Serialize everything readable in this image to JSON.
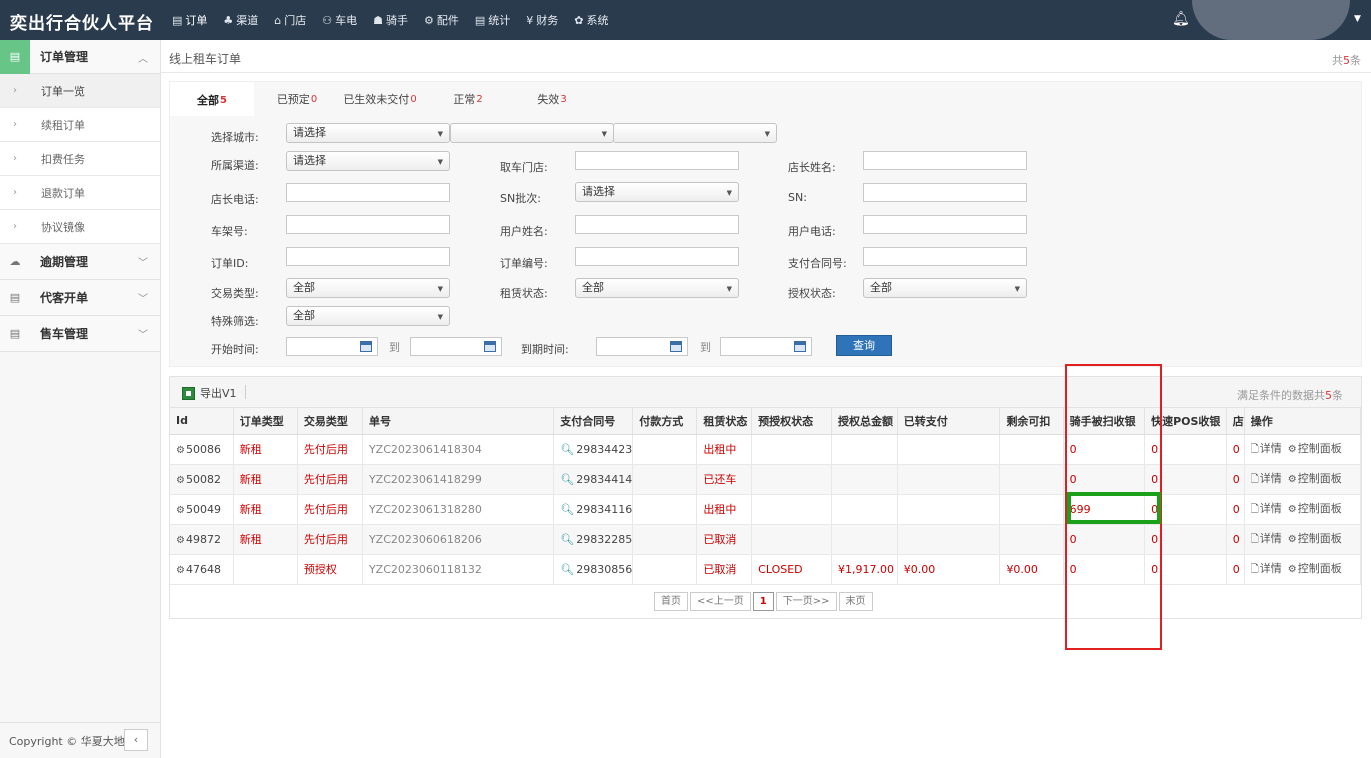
{
  "brand": "奕出行合伙人平台",
  "nav": [
    {
      "icon": "▤",
      "label": "订单",
      "active": true
    },
    {
      "icon": "♣",
      "label": "渠道"
    },
    {
      "icon": "⌂",
      "label": "门店"
    },
    {
      "icon": "⚇",
      "label": "车电"
    },
    {
      "icon": "☗",
      "label": "骑手"
    },
    {
      "icon": "⚙",
      "label": "配件"
    },
    {
      "icon": "▤",
      "label": "统计"
    },
    {
      "icon": "¥",
      "label": "财务"
    },
    {
      "icon": "✿",
      "label": "系统"
    }
  ],
  "sidebar": {
    "groups": [
      {
        "label": "订单管理",
        "chevron": "^"
      },
      {
        "label": "逾期管理",
        "chevron": "v"
      },
      {
        "label": "代客开单",
        "chevron": "v"
      },
      {
        "label": "售车管理",
        "chevron": "v"
      }
    ],
    "sub_items": [
      "订单一览",
      "续租订单",
      "扣费任务",
      "退款订单",
      "协议镜像"
    ],
    "footer": "Copyright © 华夏大地",
    "collapse": "‹"
  },
  "page": {
    "title": "线上租车订单",
    "total_prefix": "共",
    "total_count": "5",
    "total_suffix": "条"
  },
  "tabs": [
    {
      "label": "全部",
      "count": "5"
    },
    {
      "label": "已预定",
      "count": "0"
    },
    {
      "label": "已生效未交付",
      "count": "0"
    },
    {
      "label": "正常",
      "count": "2"
    },
    {
      "label": "失效",
      "count": "3"
    }
  ],
  "filters": {
    "city_label": "选择城市:",
    "city_value": "请选择",
    "channel_label": "所属渠道:",
    "channel_value": "请选择",
    "pickup_store_label": "取车门店:",
    "manager_name_label": "店长姓名:",
    "manager_phone_label": "店长电话:",
    "sn_batch_label": "SN批次:",
    "sn_batch_value": "请选择",
    "sn_label": "SN:",
    "frame_label": "车架号:",
    "user_name_label": "用户姓名:",
    "user_phone_label": "用户电话:",
    "order_id_label": "订单ID:",
    "order_no_label": "订单编号:",
    "contract_no_label": "支付合同号:",
    "trade_type_label": "交易类型:",
    "trade_type_value": "全部",
    "rent_status_label": "租赁状态:",
    "rent_status_value": "全部",
    "auth_status_label": "授权状态:",
    "auth_status_value": "全部",
    "special_label": "特殊筛选:",
    "special_value": "全部",
    "start_label": "开始时间:",
    "to1": "到",
    "expire_label": "到期时间:",
    "to2": "到",
    "query_button": "查询"
  },
  "table": {
    "export_label": "导出V1",
    "meta_prefix": "满足条件的数据共",
    "meta_count": "5",
    "meta_suffix": "条",
    "columns": [
      "Id",
      "订单类型",
      "交易类型",
      "单号",
      "支付合同号",
      "付款方式",
      "租赁状态",
      "预授权状态",
      "授权总金额",
      "已转支付",
      "剩余可扣",
      "骑手被扫收银",
      "快速POS收银",
      "店",
      "操作"
    ],
    "rows": [
      {
        "id": "50086",
        "order_type": "新租",
        "trade_type": "先付后用",
        "order_no": "YZC2023061418304",
        "contract": "29834423",
        "pay": "",
        "status": "出租中",
        "preauth": "",
        "auth_total": "",
        "transferred": "",
        "remaining": "",
        "rider_scan": "0",
        "pos": "0",
        "store": "0"
      },
      {
        "id": "50082",
        "order_type": "新租",
        "trade_type": "先付后用",
        "order_no": "YZC2023061418299",
        "contract": "29834414",
        "pay": "",
        "status": "已还车",
        "preauth": "",
        "auth_total": "",
        "transferred": "",
        "remaining": "",
        "rider_scan": "0",
        "pos": "0",
        "store": "0"
      },
      {
        "id": "50049",
        "order_type": "新租",
        "trade_type": "先付后用",
        "order_no": "YZC2023061318280",
        "contract": "29834116",
        "pay": "",
        "status": "出租中",
        "preauth": "",
        "auth_total": "",
        "transferred": "",
        "remaining": "",
        "rider_scan": "699",
        "pos": "0",
        "store": "0"
      },
      {
        "id": "49872",
        "order_type": "新租",
        "trade_type": "先付后用",
        "order_no": "YZC2023060618206",
        "contract": "29832285",
        "pay": "",
        "status": "已取消",
        "preauth": "",
        "auth_total": "",
        "transferred": "",
        "remaining": "",
        "rider_scan": "0",
        "pos": "0",
        "store": "0"
      },
      {
        "id": "47648",
        "order_type": "",
        "trade_type": "预授权",
        "order_no": "YZC2023060118132",
        "contract": "29830856",
        "pay": "",
        "status": "已取消",
        "preauth": "CLOSED",
        "auth_total": "¥1,917.00",
        "transferred": "¥0.00",
        "remaining": "¥0.00",
        "rider_scan": "0",
        "pos": "0",
        "store": "0"
      }
    ],
    "op_detail": "详情",
    "op_panel": "控制面板"
  },
  "pager": [
    "首页",
    "<<上一页",
    "1",
    "下一页>>",
    "末页"
  ],
  "colors": {
    "accent_red": "#cc0000",
    "nav_bg": "#2b3b4e",
    "highlight_red": "#e02020",
    "highlight_green": "#1aa01a",
    "query_blue": "#2f73b8"
  }
}
